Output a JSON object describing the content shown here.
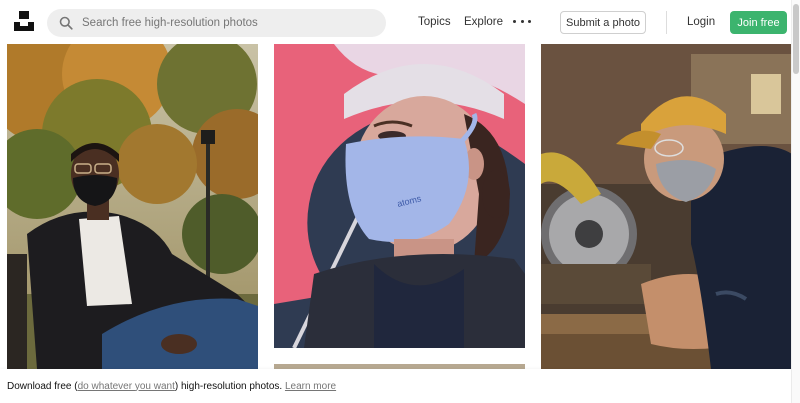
{
  "header": {
    "logo_icon": "unsplash-logo-icon",
    "search": {
      "icon": "search-icon",
      "placeholder": "Search free high-resolution photos",
      "value": ""
    },
    "nav": {
      "topics": "Topics",
      "explore": "Explore",
      "more_icon": "more-horizontal-icon"
    },
    "submit_label": "Submit a photo",
    "login_label": "Login",
    "join_label": "Join free",
    "join_color": "#3cb46e"
  },
  "photos": [
    {
      "alt": "Man wearing black face mask sitting on bench in park with autumn trees"
    },
    {
      "alt": "Woman wearing light blue atoms face mask under pink umbrella"
    },
    {
      "alt": "Man wearing grey face mask and yellow cap using a circular saw"
    }
  ],
  "photo_texts": {
    "mask_brand": "atoms"
  },
  "footer": {
    "prefix": "Download free (",
    "license_link": "do whatever you want",
    "middle": ") high-resolution photos. ",
    "learn_more": "Learn more"
  }
}
